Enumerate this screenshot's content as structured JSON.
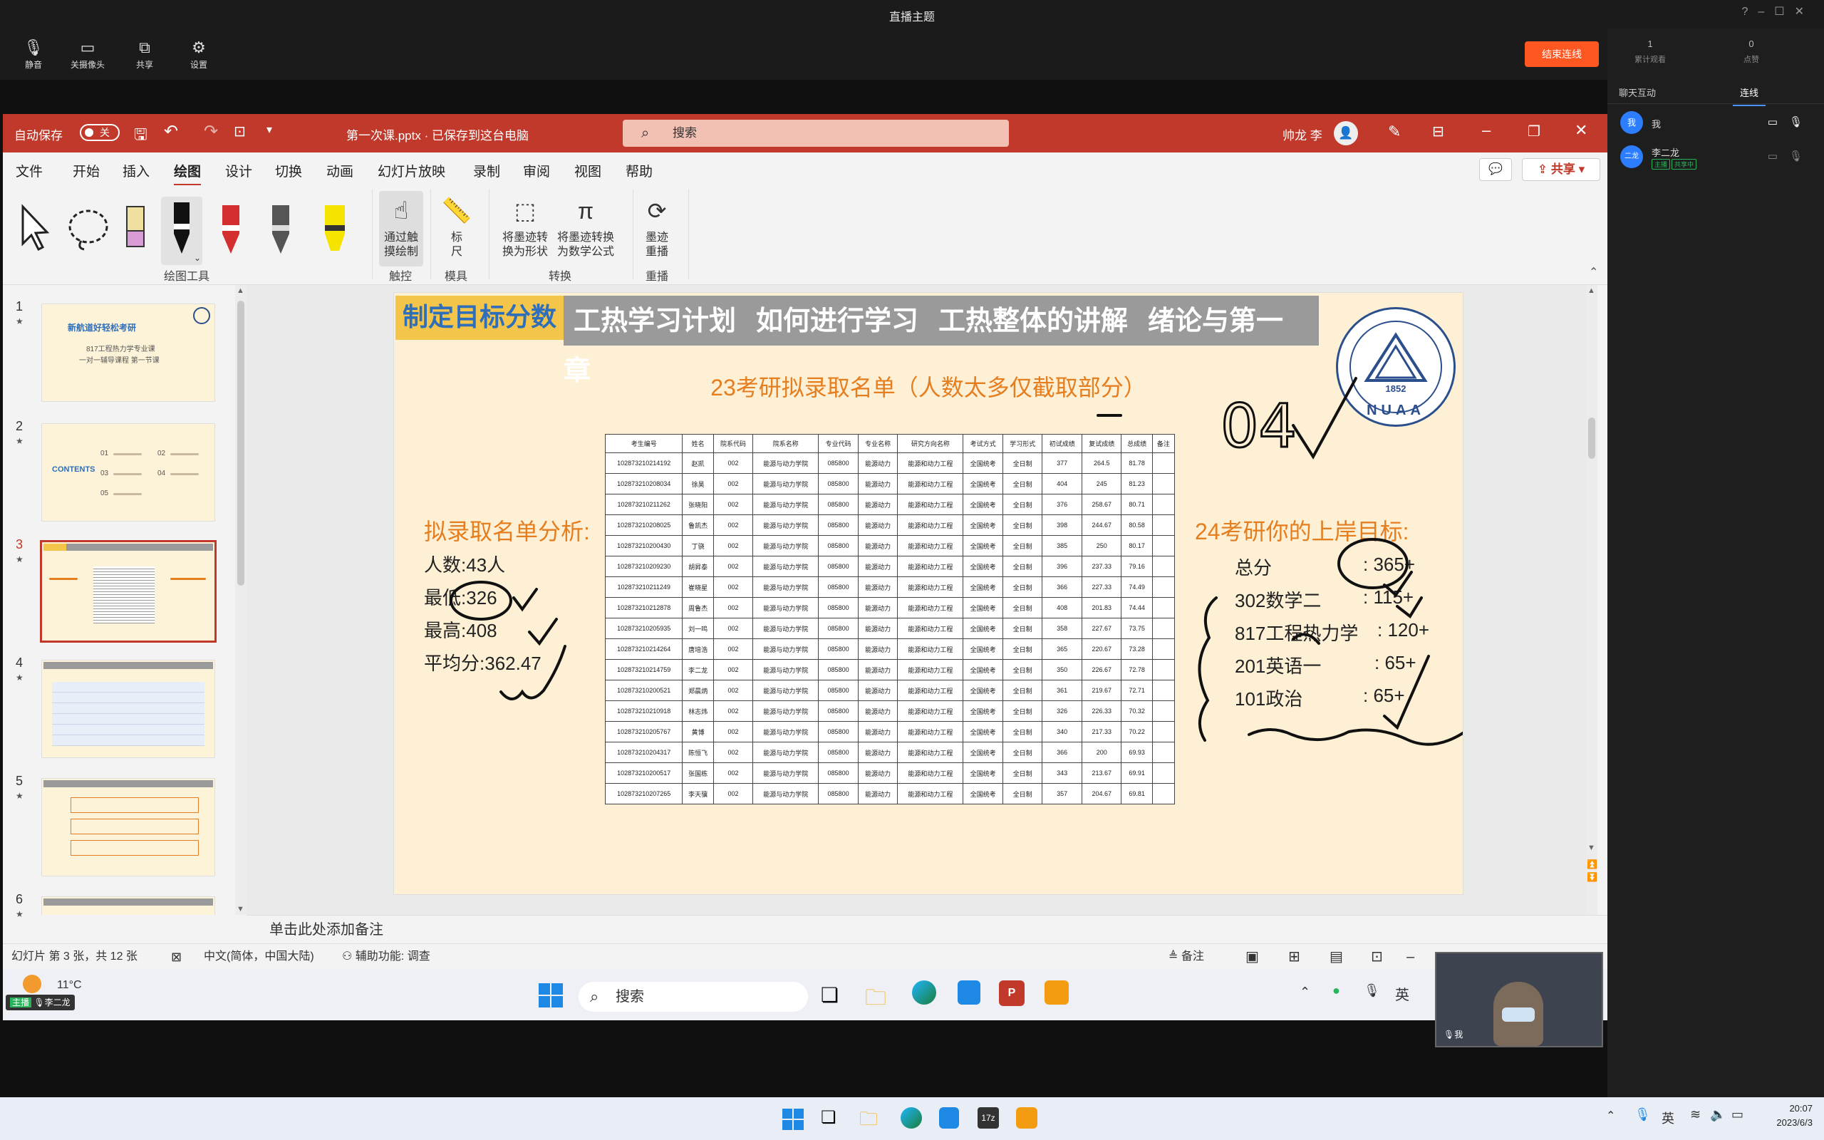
{
  "meeting": {
    "title": "直播主题",
    "toolbar": {
      "mute": "静音",
      "camera_off": "关摄像头",
      "share": "共享",
      "settings": "设置",
      "end": "结束连线"
    },
    "stats": {
      "viewers_value": "1",
      "viewers_label": "累计观看",
      "likes_value": "0",
      "likes_label": "点赞"
    },
    "panel_tabs": [
      "聊天互动",
      "连线"
    ],
    "users": [
      {
        "avatar": "我",
        "name": "我"
      },
      {
        "avatar": "二龙",
        "name": "李二龙",
        "tags": [
          "主播",
          "共享中"
        ]
      }
    ]
  },
  "ppt": {
    "autosave_label": "自动保存",
    "autosave_state": "关",
    "filename": "第一次课.pptx · 已保存到这台电脑",
    "search_placeholder": "搜索",
    "user": "帅龙 李",
    "ribbon_tabs": [
      "文件",
      "开始",
      "插入",
      "绘图",
      "设计",
      "切换",
      "动画",
      "幻灯片放映",
      "录制",
      "审阅",
      "视图",
      "帮助"
    ],
    "active_tab": "绘图",
    "share_button": "共享",
    "ribbon": {
      "touch_draw": "通过触摸绘制",
      "ruler": "标尺",
      "ink_to_shape": "将墨迹转换为形状",
      "ink_to_math": "将墨迹转换为数学公式",
      "ink_replay": "墨迹重播",
      "groups": [
        "绘图工具",
        "触控",
        "模具",
        "转换",
        "重播"
      ]
    },
    "thumbs": [
      {
        "num": "1",
        "title": "新航道好轻松考研",
        "sub1": "817工程热力学专业课",
        "sub2": "一对一辅导课程 第一节课"
      },
      {
        "num": "2",
        "title": "CONTENTS",
        "items": [
          "01",
          "02",
          "03",
          "04",
          "05"
        ]
      },
      {
        "num": "3"
      },
      {
        "num": "4"
      },
      {
        "num": "5"
      },
      {
        "num": "6"
      }
    ],
    "notes_placeholder": "单击此处添加备注",
    "status": {
      "slide_info": "幻灯片 第 3 张，共 12 张",
      "language": "中文(简体，中国大陆)",
      "accessibility": "辅助功能: 调查",
      "notes": "备注"
    }
  },
  "slide": {
    "goal_tag": "制定目标分数",
    "top_tags": [
      "工热学习计划",
      "如何进行学习",
      "工热整体的讲解",
      "绪论与第一章"
    ],
    "list_title": "23考研拟录取名单（人数太多仅截取部分）",
    "analysis_title": "拟录取名单分析:",
    "analysis": [
      {
        "label": "人数:",
        "value": "43人"
      },
      {
        "label": "最低:",
        "value": "326"
      },
      {
        "label": "最高:",
        "value": "408"
      },
      {
        "label": "平均分:",
        "value": "362.47"
      }
    ],
    "target_title": "24考研你的上岸目标:",
    "targets": [
      {
        "label": "总分",
        "value": ": 365+"
      },
      {
        "label": "302数学二",
        "value": ": 115+"
      },
      {
        "label": "817工程热力学",
        "value": ": 120+"
      },
      {
        "label": "201英语一",
        "value": ": 65+"
      },
      {
        "label": "101政治",
        "value": ": 65+"
      }
    ],
    "handwriting": "04",
    "logo_text": "NUAA",
    "logo_year": "1852",
    "table": {
      "headers": [
        "考生编号",
        "姓名",
        "院系代码",
        "院系名称",
        "专业代码",
        "专业名称",
        "研究方向名称",
        "考试方式",
        "学习形式",
        "初试成绩",
        "复试成绩",
        "总成绩",
        "备注"
      ],
      "rows": [
        [
          "102873210214192",
          "赵凯",
          "002",
          "能源与动力学院",
          "085800",
          "能源动力",
          "能源和动力工程",
          "全国统考",
          "全日制",
          "377",
          "264.5",
          "81.78",
          ""
        ],
        [
          "102873210208034",
          "徐昊",
          "002",
          "能源与动力学院",
          "085800",
          "能源动力",
          "能源和动力工程",
          "全国统考",
          "全日制",
          "404",
          "245",
          "81.23",
          ""
        ],
        [
          "102873210211262",
          "张晓阳",
          "002",
          "能源与动力学院",
          "085800",
          "能源动力",
          "能源和动力工程",
          "全国统考",
          "全日制",
          "376",
          "258.67",
          "80.71",
          ""
        ],
        [
          "102873210208025",
          "鲁凯杰",
          "002",
          "能源与动力学院",
          "085800",
          "能源动力",
          "能源和动力工程",
          "全国统考",
          "全日制",
          "398",
          "244.67",
          "80.58",
          ""
        ],
        [
          "102873210200430",
          "丁骁",
          "002",
          "能源与动力学院",
          "085800",
          "能源动力",
          "能源和动力工程",
          "全国统考",
          "全日制",
          "385",
          "250",
          "80.17",
          ""
        ],
        [
          "102873210209230",
          "胡昇泰",
          "002",
          "能源与动力学院",
          "085800",
          "能源动力",
          "能源和动力工程",
          "全国统考",
          "全日制",
          "396",
          "237.33",
          "79.16",
          ""
        ],
        [
          "102873210211249",
          "崔晓星",
          "002",
          "能源与动力学院",
          "085800",
          "能源动力",
          "能源和动力工程",
          "全国统考",
          "全日制",
          "366",
          "227.33",
          "74.49",
          ""
        ],
        [
          "102873210212878",
          "周鲁杰",
          "002",
          "能源与动力学院",
          "085800",
          "能源动力",
          "能源和动力工程",
          "全国统考",
          "全日制",
          "408",
          "201.83",
          "74.44",
          ""
        ],
        [
          "102873210205935",
          "刘一鸣",
          "002",
          "能源与动力学院",
          "085800",
          "能源动力",
          "能源和动力工程",
          "全国统考",
          "全日制",
          "358",
          "227.67",
          "73.75",
          ""
        ],
        [
          "102873210214264",
          "唐培浩",
          "002",
          "能源与动力学院",
          "085800",
          "能源动力",
          "能源和动力工程",
          "全国统考",
          "全日制",
          "365",
          "220.67",
          "73.28",
          ""
        ],
        [
          "102873210214759",
          "李二龙",
          "002",
          "能源与动力学院",
          "085800",
          "能源动力",
          "能源和动力工程",
          "全国统考",
          "全日制",
          "350",
          "226.67",
          "72.78",
          ""
        ],
        [
          "102873210200521",
          "郑晨炳",
          "002",
          "能源与动力学院",
          "085800",
          "能源动力",
          "能源和动力工程",
          "全国统考",
          "全日制",
          "361",
          "219.67",
          "72.71",
          ""
        ],
        [
          "102873210210918",
          "林志炜",
          "002",
          "能源与动力学院",
          "085800",
          "能源动力",
          "能源和动力工程",
          "全国统考",
          "全日制",
          "326",
          "226.33",
          "70.32",
          ""
        ],
        [
          "102873210205767",
          "黄博",
          "002",
          "能源与动力学院",
          "085800",
          "能源动力",
          "能源和动力工程",
          "全国统考",
          "全日制",
          "340",
          "217.33",
          "70.22",
          ""
        ],
        [
          "102873210204317",
          "陈恒飞",
          "002",
          "能源与动力学院",
          "085800",
          "能源动力",
          "能源和动力工程",
          "全国统考",
          "全日制",
          "366",
          "200",
          "69.93",
          ""
        ],
        [
          "102873210200517",
          "张国栋",
          "002",
          "能源与动力学院",
          "085800",
          "能源动力",
          "能源和动力工程",
          "全国统考",
          "全日制",
          "343",
          "213.67",
          "69.91",
          ""
        ],
        [
          "102873210207265",
          "李天骥",
          "002",
          "能源与动力学院",
          "085800",
          "能源动力",
          "能源和动力工程",
          "全国统考",
          "全日制",
          "357",
          "204.67",
          "69.81",
          ""
        ]
      ]
    }
  },
  "inner_taskbar": {
    "weather": "11°C",
    "search": "搜索",
    "ime": "英",
    "chips": [
      "主播",
      "李二龙"
    ],
    "webcam_label": "我"
  },
  "outer_taskbar": {
    "ime": "英",
    "time": "20:07",
    "date": "2023/6/3"
  },
  "colors": {
    "ppt_red": "#c0392b",
    "end_btn": "#ff5722",
    "slide_bg": "#fdf0d5",
    "accent_orange": "#e57e1f"
  }
}
